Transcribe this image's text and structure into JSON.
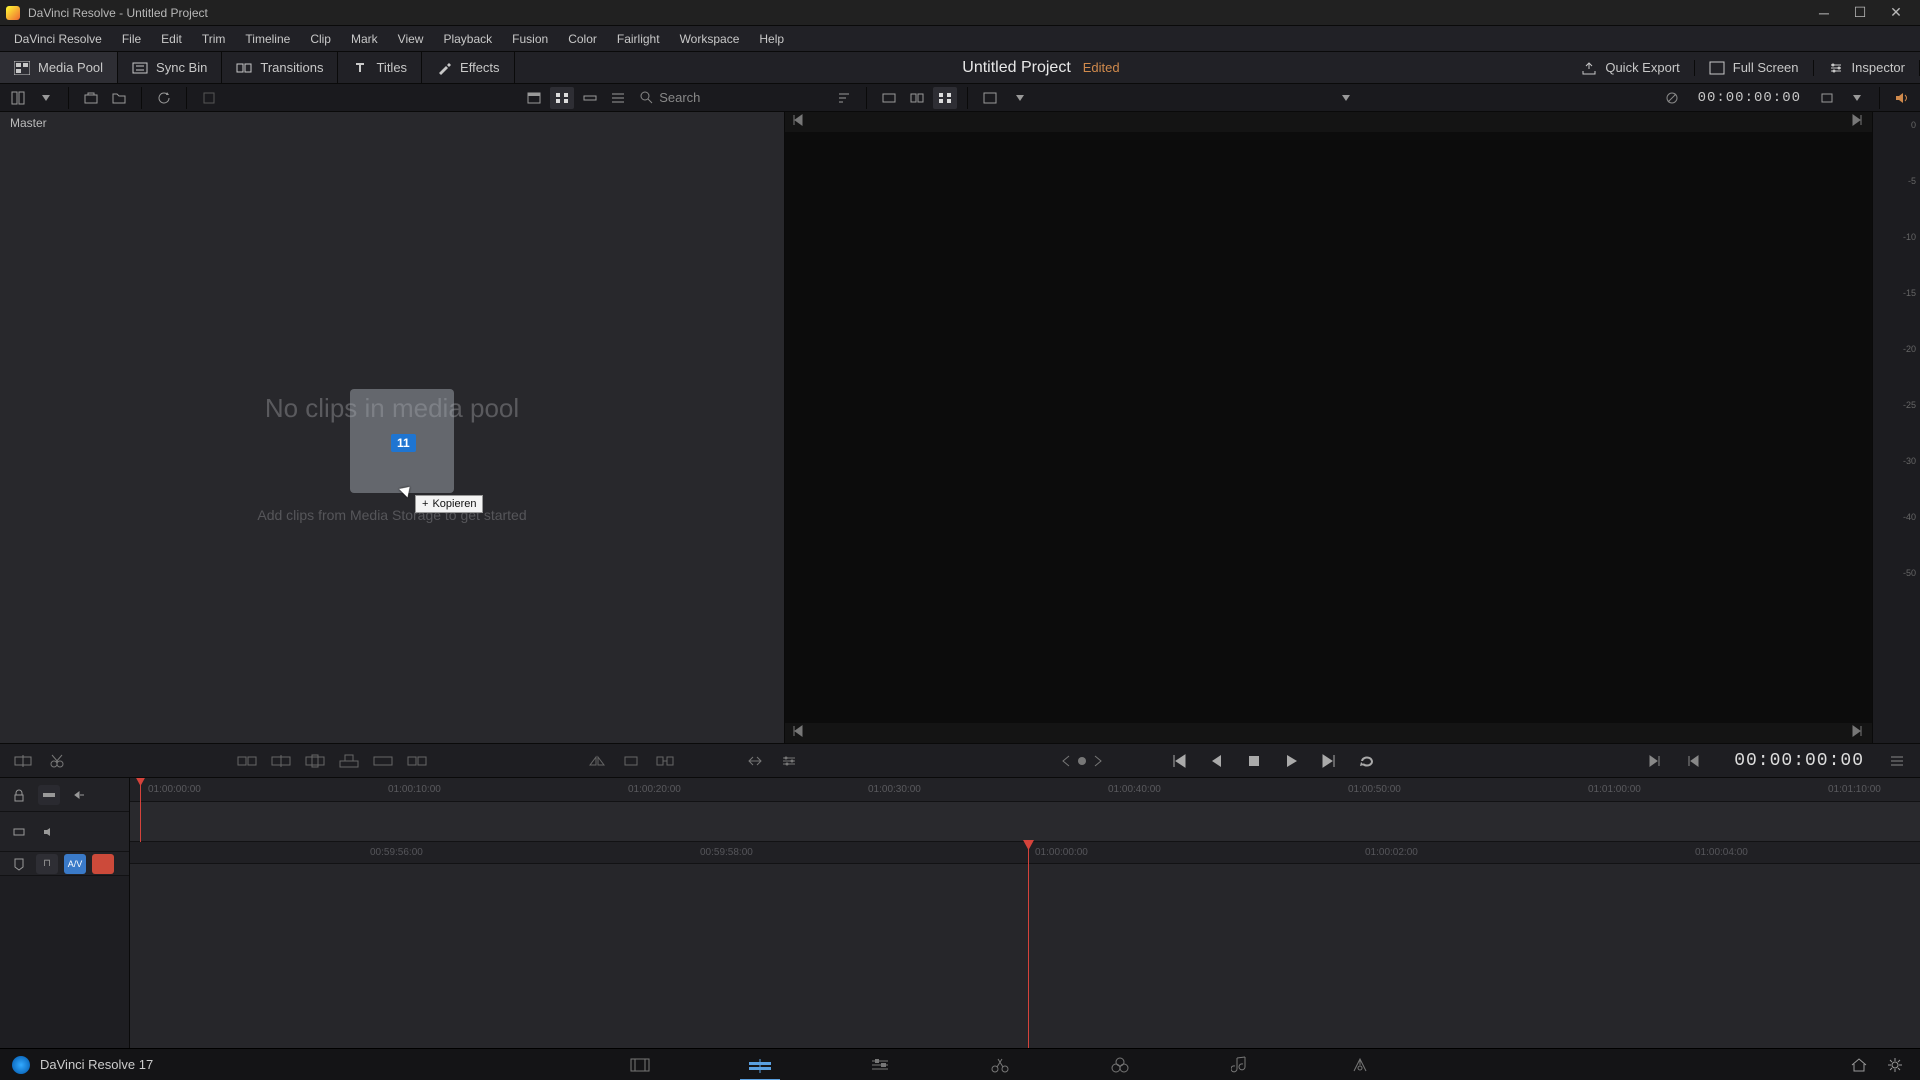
{
  "titlebar": {
    "text": "DaVinci Resolve - Untitled Project"
  },
  "menu": [
    "DaVinci Resolve",
    "File",
    "Edit",
    "Trim",
    "Timeline",
    "Clip",
    "Mark",
    "View",
    "Playback",
    "Fusion",
    "Color",
    "Fairlight",
    "Workspace",
    "Help"
  ],
  "wsbar": {
    "media_pool": "Media Pool",
    "sync_bin": "Sync Bin",
    "transitions": "Transitions",
    "titles": "Titles",
    "effects": "Effects",
    "project": "Untitled Project",
    "edited": "Edited",
    "quick_export": "Quick Export",
    "full_screen": "Full Screen",
    "inspector": "Inspector"
  },
  "toolbar2": {
    "search_placeholder": "Search",
    "timecode": "00:00:00:00"
  },
  "mediapool": {
    "master": "Master",
    "empty_h": "No clips in media pool",
    "empty_s": "Add clips from Media Storage to get started",
    "drag_count": "11",
    "drag_tip": "Kopieren"
  },
  "meters": [
    "0",
    "-5",
    "-10",
    "-15",
    "-20",
    "-25",
    "-30",
    "-40",
    "-50"
  ],
  "transport": {
    "timecode": "00:00:00:00"
  },
  "ruler_a": [
    "01:00:00:00",
    "01:00:10:00",
    "01:00:20:00",
    "01:00:30:00",
    "01:00:40:00",
    "01:00:50:00",
    "01:01:00:00",
    "01:01:10:00"
  ],
  "ruler_b": [
    "00:59:56:00",
    "00:59:58:00",
    "01:00:00:00",
    "01:00:02:00",
    "01:00:04:00"
  ],
  "pagebar": {
    "label": "DaVinci Resolve 17"
  }
}
